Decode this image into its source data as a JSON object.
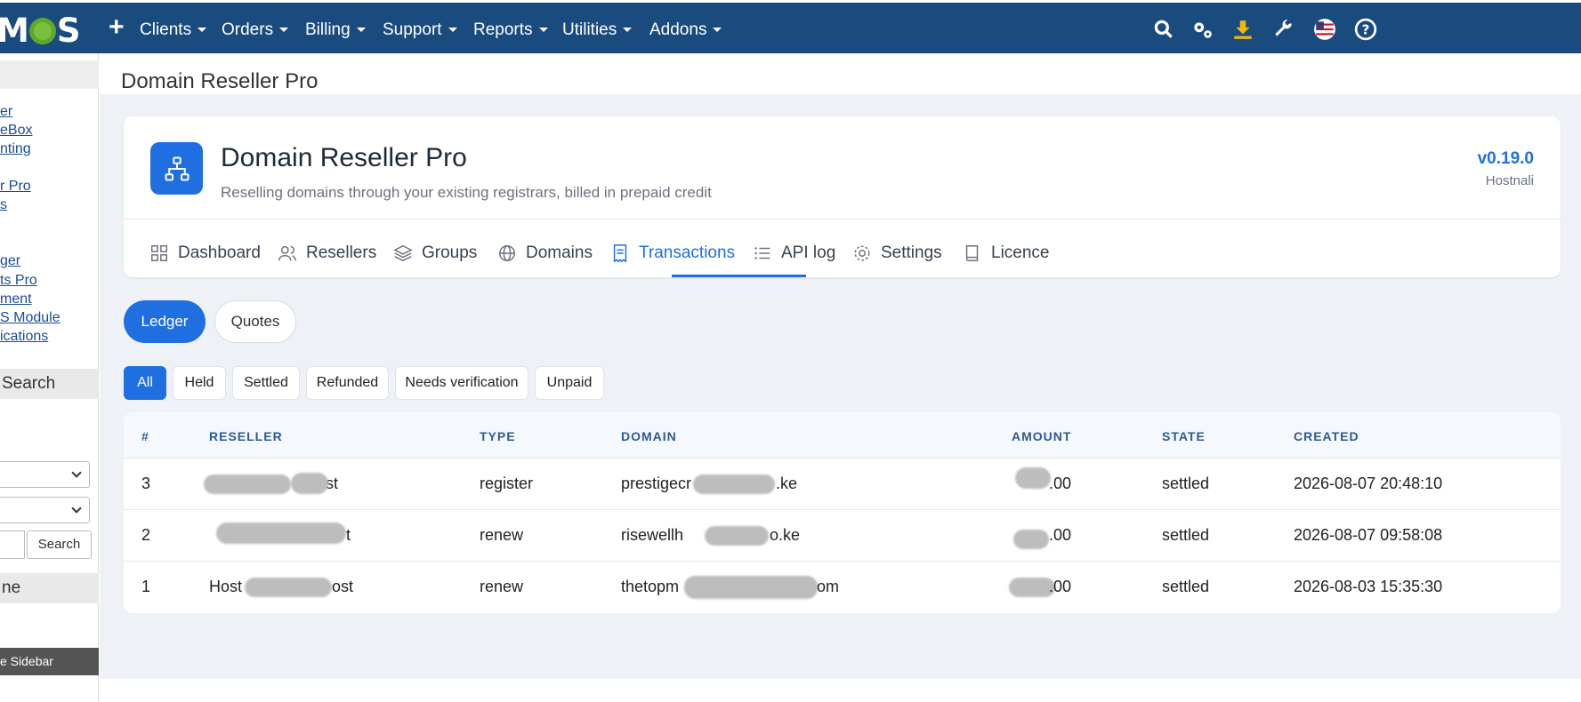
{
  "topbar": {
    "logo": "MCS",
    "nav": [
      "Clients",
      "Orders",
      "Billing",
      "Support",
      "Reports",
      "Utilities",
      "Addons"
    ],
    "icons": [
      "search-icon",
      "cogs-icon",
      "download-icon",
      "wrench-icon",
      "flag-icon",
      "help-icon"
    ]
  },
  "sidebar": {
    "links": [
      "er",
      "eBox",
      "nting",
      "r Pro",
      "s",
      "ger",
      "ts Pro",
      "ment",
      "S Module",
      "ications"
    ],
    "search_section": "Search",
    "search_button": "Search",
    "section2": "ne",
    "minimize": "e Sidebar"
  },
  "page": {
    "title": "Domain Reseller Pro"
  },
  "module": {
    "name": "Domain Reseller Pro",
    "description": "Reselling domains through your existing registrars, billed in prepaid credit",
    "version": "v0.19.0",
    "vendor": "Hostnali"
  },
  "tabs": [
    "Dashboard",
    "Resellers",
    "Groups",
    "Domains",
    "Transactions",
    "API log",
    "Settings",
    "Licence"
  ],
  "active_tab": "Transactions",
  "views": {
    "ledger": "Ledger",
    "quotes": "Quotes"
  },
  "filters": [
    "All",
    "Held",
    "Settled",
    "Refunded",
    "Needs verification",
    "Unpaid"
  ],
  "table": {
    "headers": [
      "#",
      "RESELLER",
      "TYPE",
      "DOMAIN",
      "AMOUNT",
      "STATE",
      "CREATED"
    ],
    "rows": [
      {
        "id": "3",
        "reseller": "ost",
        "type": "register",
        "domain": "prestigecr",
        "domain_tail": ".ke",
        "amount": ".00",
        "state": "settled",
        "created": "2026-08-07 20:48:10"
      },
      {
        "id": "2",
        "reseller": "t",
        "type": "renew",
        "domain": "risewellh",
        "domain_tail": "o.ke",
        "amount": ".00",
        "state": "settled",
        "created": "2026-08-07 09:58:08"
      },
      {
        "id": "1",
        "reseller": "Host",
        "reseller_tail": "ost",
        "type": "renew",
        "domain": "thetopm",
        "domain_tail": "om",
        "amount": ".00",
        "state": "settled",
        "created": "2026-08-03 15:35:30"
      }
    ]
  },
  "colors": {
    "navbar": "#1a4b7e",
    "accent": "#1f6fe0",
    "content_bg": "#eef1f5"
  }
}
